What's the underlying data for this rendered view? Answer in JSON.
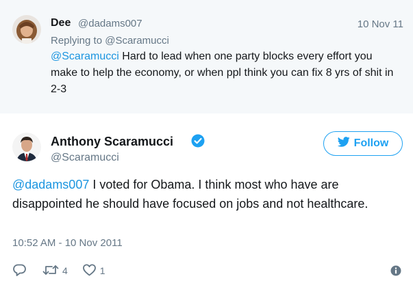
{
  "reply": {
    "name": "Dee",
    "handle": "@dadams007",
    "date": "10 Nov 11",
    "replying_prefix": "Replying to",
    "replying_to": "@Scaramucci",
    "mention": "@Scaramucci",
    "text": " Hard to lead when one party blocks every effort you make to help the economy, or when ppl think you can fix 8 yrs of shit in 2-3"
  },
  "tweet": {
    "name": "Anthony Scaramucci",
    "handle": "@Scaramucci",
    "follow_label": "Follow",
    "mention": "@dadams007",
    "text": " I voted for Obama. I think most who have are disappointed he should have focused on jobs and not healthcare.",
    "timestamp": "10:52 AM - 10 Nov 2011",
    "retweet_count": "4",
    "like_count": "1"
  },
  "colors": {
    "accent": "#1da1f2",
    "mention": "#1b95e0",
    "secondary_text": "#657786",
    "reply_background": "#f5f8fa"
  },
  "icons": [
    "reply-icon",
    "retweet-icon",
    "like-icon",
    "info-icon",
    "verified-badge-icon",
    "bird-icon"
  ]
}
